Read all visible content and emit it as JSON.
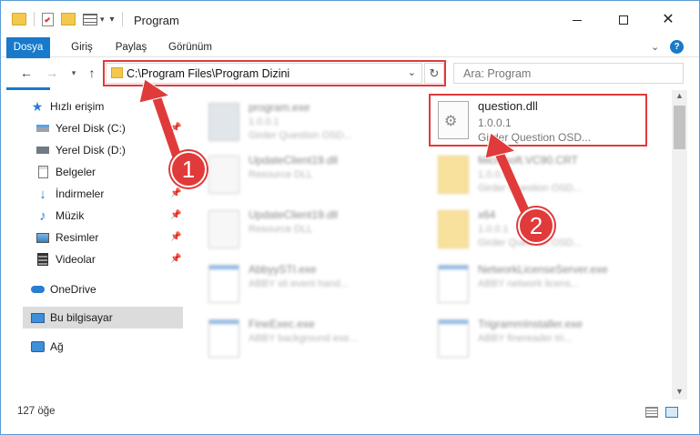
{
  "titlebar": {
    "title": "Program",
    "minimize_icon": "minimize-icon",
    "maximize_icon": "maximize-icon",
    "close_icon": "close-icon"
  },
  "ribbon": {
    "tabs": [
      {
        "label": "Dosya"
      },
      {
        "label": "Giriş"
      },
      {
        "label": "Paylaş"
      },
      {
        "label": "Görünüm"
      }
    ]
  },
  "navbar": {
    "address": "C:\\Program Files\\Program Dizini",
    "search_placeholder": "Ara: Program"
  },
  "sidebar": {
    "items": [
      {
        "label": "Hızlı erişim",
        "icon": "star-icon",
        "pinned": false
      },
      {
        "label": "Yerel Disk (C:)",
        "icon": "drive-icon",
        "pinned": true
      },
      {
        "label": "Yerel Disk (D:)",
        "icon": "drive-icon",
        "pinned": true
      },
      {
        "label": "Belgeler",
        "icon": "documents-icon",
        "pinned": true
      },
      {
        "label": "İndirmeler",
        "icon": "download-icon",
        "pinned": true
      },
      {
        "label": "Müzik",
        "icon": "music-icon",
        "pinned": true
      },
      {
        "label": "Resimler",
        "icon": "pictures-icon",
        "pinned": true
      },
      {
        "label": "Videolar",
        "icon": "videos-icon",
        "pinned": true
      },
      {
        "label": "OneDrive",
        "icon": "cloud-icon",
        "pinned": false
      },
      {
        "label": "Bu bilgisayar",
        "icon": "computer-icon",
        "pinned": false,
        "selected": true
      },
      {
        "label": "Ağ",
        "icon": "network-icon",
        "pinned": false
      }
    ]
  },
  "files": [
    {
      "name": "program.exe",
      "meta1": "1.0.0.1",
      "meta2": "Girder Question OSD...",
      "blurred": true
    },
    {
      "name": "question.dll",
      "meta1": "1.0.0.1",
      "meta2": "Girder Question OSD...",
      "blurred": false
    },
    {
      "name": "UpdateClient19.dll",
      "meta1": "Resource DLL",
      "meta2": "",
      "blurred": true
    },
    {
      "name": "Microsoft.VC90.CRT",
      "meta1": "1.0.0.1",
      "meta2": "Girder Question OSD...",
      "blurred": true
    },
    {
      "name": "UpdateClient19.dll",
      "meta1": "Resource DLL",
      "meta2": "",
      "blurred": true
    },
    {
      "name": "x64",
      "meta1": "1.0.0.1",
      "meta2": "Girder Question OSD...",
      "blurred": true
    },
    {
      "name": "AbbyySTI.exe",
      "meta1": "ABBY sti event hand...",
      "meta2": "",
      "blurred": true
    },
    {
      "name": "NetworkLicenseServer.exe",
      "meta1": "ABBY network licens...",
      "meta2": "",
      "blurred": true
    },
    {
      "name": "FineExec.exe",
      "meta1": "ABBY background exe...",
      "meta2": "",
      "blurred": true
    },
    {
      "name": "TrigrammInstaller.exe",
      "meta1": "ABBY finereader tri...",
      "meta2": "",
      "blurred": true
    }
  ],
  "status": {
    "count": "127 öğe"
  },
  "annotations": {
    "step1": "1",
    "step2": "2",
    "accent": "#e03a3a"
  }
}
